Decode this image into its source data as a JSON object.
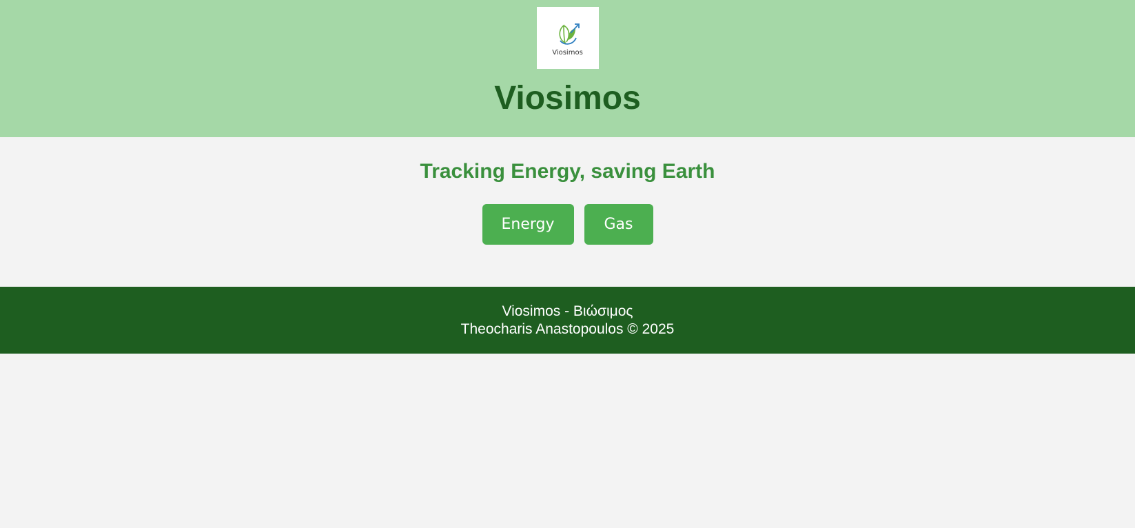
{
  "header": {
    "logo": {
      "icon": "leaf-arrow-icon",
      "text": "Viosimos"
    },
    "title": "Viosimos"
  },
  "main": {
    "tagline": "Tracking Energy, saving Earth",
    "buttons": [
      {
        "label": "Energy"
      },
      {
        "label": "Gas"
      }
    ]
  },
  "footer": {
    "line1": "Viosimos - Βιώσιμος",
    "line2": "Theocharis Anastopoulos © 2025"
  },
  "colors": {
    "header_bg": "#a5d8a7",
    "title": "#1e5e20",
    "tagline": "#3a903d",
    "button_bg": "#4caf50",
    "footer_bg": "#1e5e20",
    "page_bg": "#f3f3f3"
  }
}
